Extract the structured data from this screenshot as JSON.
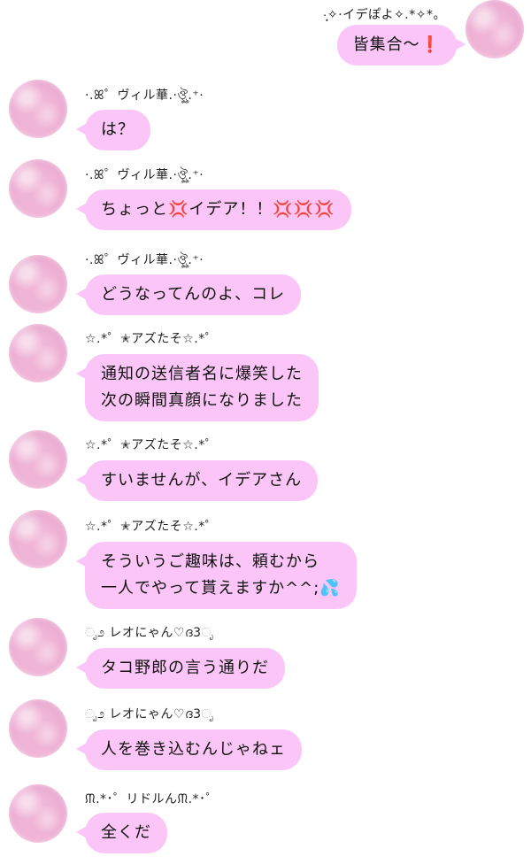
{
  "messages": [
    {
      "sender": "·̩͙✧·イデぽよ✧.*✧*。",
      "text": "皆集合〜❗️",
      "side": "right"
    },
    {
      "sender": "·.ꕤ゜ヴィル華.·ঔৣ.⁺·",
      "text": "は？",
      "side": "left"
    },
    {
      "sender": "·.ꕤ゜ヴィル華.·ঔৣ.⁺·",
      "text": "ちょっと💢イデア！！💢💢💢",
      "side": "left"
    },
    {
      "sender": "·.ꕤ゜ヴィル華.·ঔৣ.⁺·",
      "text": "どうなってんのよ、コレ",
      "side": "left"
    },
    {
      "sender": "☆.*゜✭アズたそ☆.*゜",
      "text": "通知の送信者名に爆笑した\n次の瞬間真顔になりました",
      "side": "left"
    },
    {
      "sender": "☆.*゜✭アズたそ☆.*゜",
      "text": "すいませんが、イデアさん",
      "side": "left"
    },
    {
      "sender": "☆.*゜✭アズたそ☆.*゜",
      "text": "そういうご趣味は、頼むから\n一人でやって貰えますか^^;💦",
      "side": "left"
    },
    {
      "sender": "ೃ೨ レオにゃん♡ദ3ೃ",
      "text": "タコ野郎の言う通りだ",
      "side": "left"
    },
    {
      "sender": "ೃ೨ レオにゃん♡ദ3ೃ",
      "text": "人を巻き込むんじゃねェ",
      "side": "left"
    },
    {
      "sender": "ᙏ.*･゜リドルんᙏ.*･゜",
      "text": "全くだ",
      "side": "left"
    }
  ]
}
